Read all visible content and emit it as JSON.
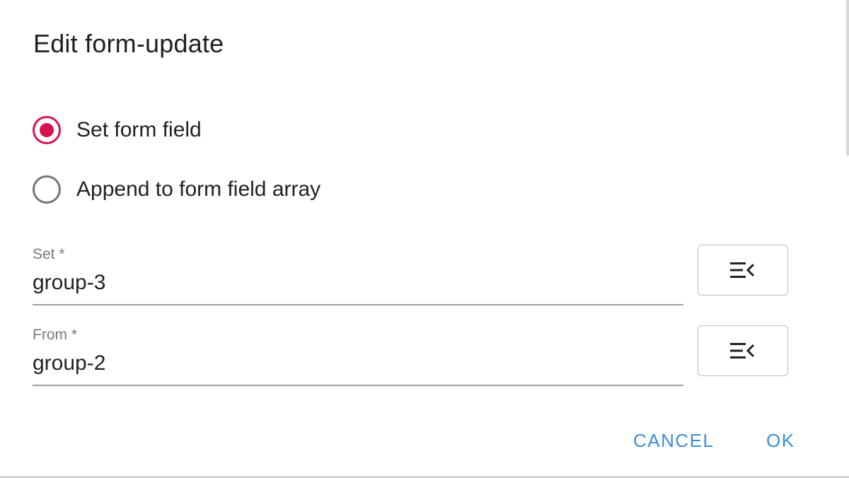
{
  "dialog": {
    "title": "Edit form-update",
    "options": [
      {
        "label": "Set form field",
        "selected": true
      },
      {
        "label": "Append to form field array",
        "selected": false
      }
    ],
    "fields": [
      {
        "label": "Set *",
        "value": "group-3",
        "button_icon": "menu-collapse-icon"
      },
      {
        "label": "From *",
        "value": "group-2",
        "button_icon": "menu-collapse-icon"
      }
    ],
    "actions": {
      "cancel_label": "CANCEL",
      "ok_label": "OK"
    }
  },
  "colors": {
    "accent": "#d9124f",
    "action": "#3b8fd6",
    "text": "#212121",
    "muted": "#7a7a7a"
  }
}
